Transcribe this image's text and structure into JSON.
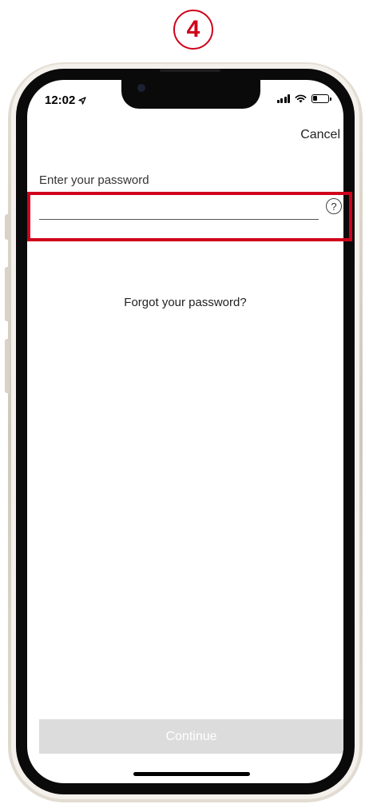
{
  "annotation": {
    "step_number": "4",
    "accent_color": "#d0021b"
  },
  "status_bar": {
    "time": "12:02",
    "location_icon": "location-arrow-icon",
    "signal_icon": "cellular-signal-icon",
    "wifi_icon": "wifi-icon",
    "battery_icon": "battery-icon"
  },
  "header": {
    "cancel_label": "Cancel"
  },
  "password": {
    "label": "Enter your password",
    "value": "",
    "help_icon": "question-circle-icon",
    "help_glyph": "?"
  },
  "links": {
    "forgot_password": "Forgot your password?"
  },
  "footer": {
    "continue_label": "Continue",
    "continue_enabled": false,
    "continue_bg": "#dcdcdc"
  }
}
